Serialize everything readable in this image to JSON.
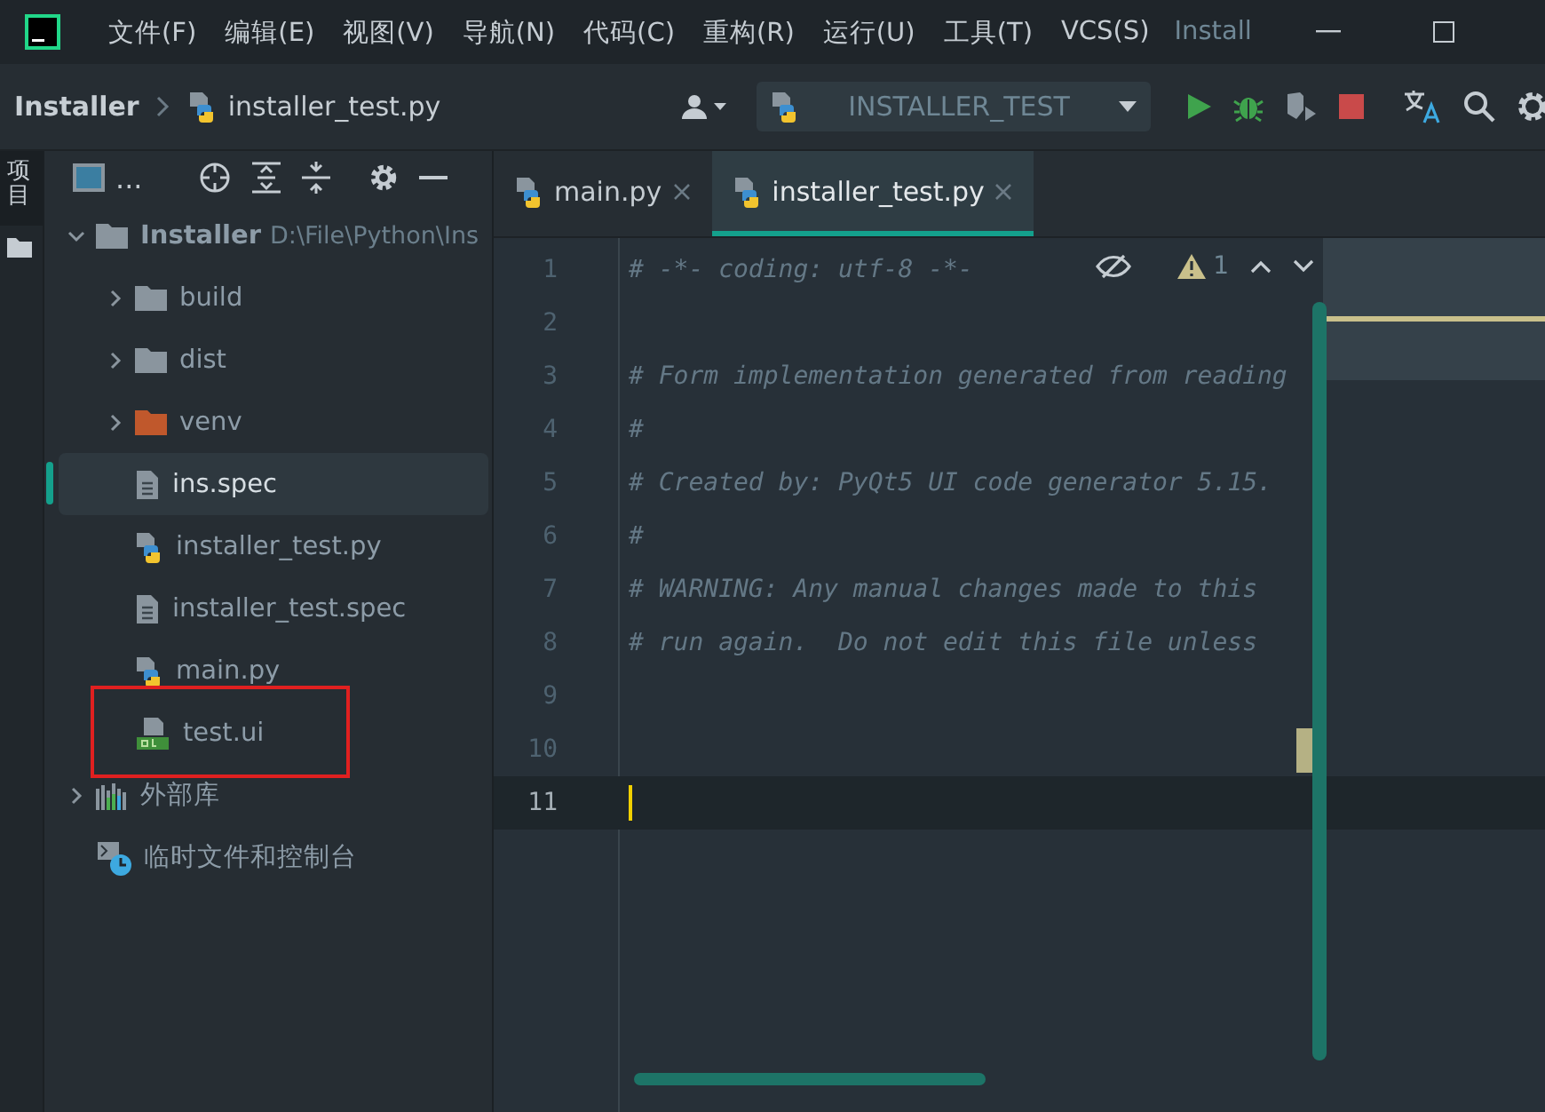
{
  "title_bar": {
    "menu": [
      {
        "label": "文件(F)"
      },
      {
        "label": "编辑(E)"
      },
      {
        "label": "视图(V)"
      },
      {
        "label": "导航(N)"
      },
      {
        "label": "代码(C)"
      },
      {
        "label": "重构(R)"
      },
      {
        "label": "运行(U)"
      },
      {
        "label": "工具(T)"
      },
      {
        "label": "VCS(S)"
      }
    ],
    "project_title": "Install"
  },
  "nav_bar": {
    "crumbs": [
      "Installer",
      "installer_test.py"
    ],
    "run_config": "INSTALLER_TEST"
  },
  "tool_strip": {
    "tab": "项目"
  },
  "project_panel": {
    "title": "...",
    "tree": [
      {
        "kind": "module",
        "name": "Installer",
        "path": "D:\\File\\Python\\Ins",
        "expanded": true,
        "selected": false,
        "children": [
          {
            "kind": "folder",
            "name": "build",
            "expanded": false,
            "selected": false
          },
          {
            "kind": "folder",
            "name": "dist",
            "expanded": false,
            "selected": false
          },
          {
            "kind": "excluded_folder",
            "name": "venv",
            "expanded": false,
            "selected": false
          },
          {
            "kind": "text_file",
            "name": "ins.spec",
            "selected": true
          },
          {
            "kind": "python_file",
            "name": "installer_test.py",
            "selected": false
          },
          {
            "kind": "text_file",
            "name": "installer_test.spec",
            "selected": false
          },
          {
            "kind": "python_file",
            "name": "main.py",
            "selected": false
          },
          {
            "kind": "qt_file",
            "name": "test.ui",
            "selected": false
          }
        ]
      },
      {
        "kind": "libraries",
        "name": "外部库",
        "expanded": false,
        "selected": false
      },
      {
        "kind": "scratches",
        "name": "临时文件和控制台",
        "selected": false
      }
    ]
  },
  "editor": {
    "tabs": [
      {
        "label": "main.py",
        "selected": false
      },
      {
        "label": "installer_test.py",
        "selected": true
      }
    ],
    "inspections": {
      "warnings": "1"
    },
    "lines": [
      {
        "number": "1",
        "text": "# -*- coding: utf-8 -*-",
        "current": false
      },
      {
        "number": "2",
        "current": false
      },
      {
        "number": "3",
        "text": "# Form implementation generated from reading",
        "current": false
      },
      {
        "number": "4",
        "text": "#",
        "current": false
      },
      {
        "number": "5",
        "text": "# Created by: PyQt5 UI code generator 5.15.",
        "current": false
      },
      {
        "number": "6",
        "text": "#",
        "current": false
      },
      {
        "number": "7",
        "text": "# WARNING: Any manual changes made to this",
        "current": false
      },
      {
        "number": "8",
        "text": "# run again.  Do not edit this file unless",
        "current": false
      },
      {
        "number": "9",
        "current": false
      },
      {
        "number": "10",
        "current": false
      },
      {
        "number": "11",
        "current": true
      }
    ]
  }
}
